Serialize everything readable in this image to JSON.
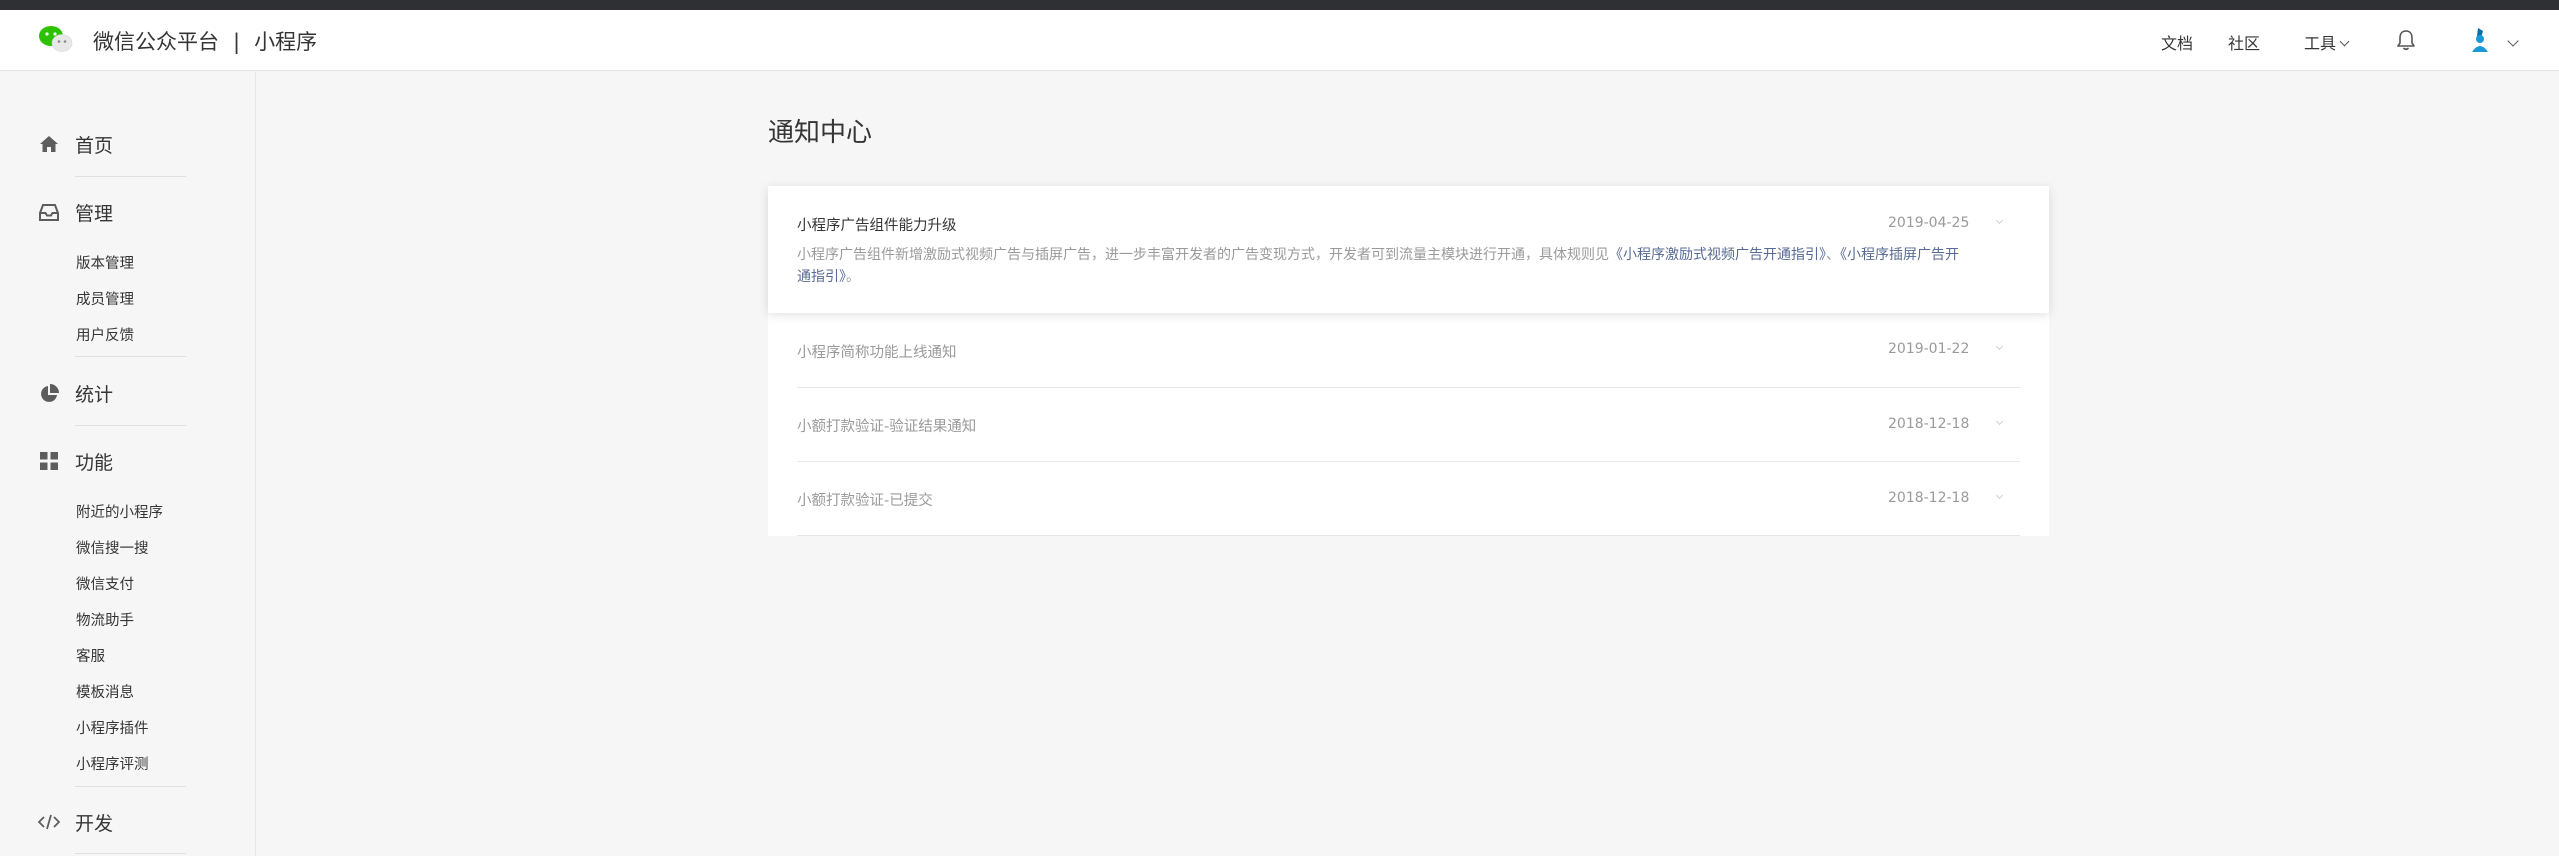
{
  "header": {
    "brand": "微信公众平台",
    "separator": "|",
    "product": "小程序",
    "nav": {
      "docs": "文档",
      "community": "社区",
      "tools": "工具"
    }
  },
  "sidebar": {
    "home": "首页",
    "manage": {
      "label": "管理",
      "items": [
        "版本管理",
        "成员管理",
        "用户反馈"
      ]
    },
    "stats": "统计",
    "features": {
      "label": "功能",
      "items": [
        "附近的小程序",
        "微信搜一搜",
        "微信支付",
        "物流助手",
        "客服",
        "模板消息",
        "小程序插件",
        "小程序评测"
      ]
    },
    "develop": "开发"
  },
  "main": {
    "title": "通知中心",
    "notifications": [
      {
        "title": "小程序广告组件能力升级",
        "date": "2019-04-25",
        "desc_text": "小程序广告组件新增激励式视频广告与插屏广告，进一步丰富开发者的广告变现方式，开发者可到流量主模块进行开通，具体规则见",
        "link1": "《小程序激励式视频广告开通指引》",
        "mid": "、",
        "link2": "《小程序插屏广告开通指引》",
        "end": "。"
      },
      {
        "title": "小程序简称功能上线通知",
        "date": "2019-01-22"
      },
      {
        "title": "小额打款验证-验证结果通知",
        "date": "2018-12-18"
      },
      {
        "title": "小额打款验证-已提交",
        "date": "2018-12-18"
      }
    ]
  },
  "colors": {
    "accent_link": "#576b95",
    "top_strip": "#2e3033",
    "wechat_green": "#2dc100"
  }
}
